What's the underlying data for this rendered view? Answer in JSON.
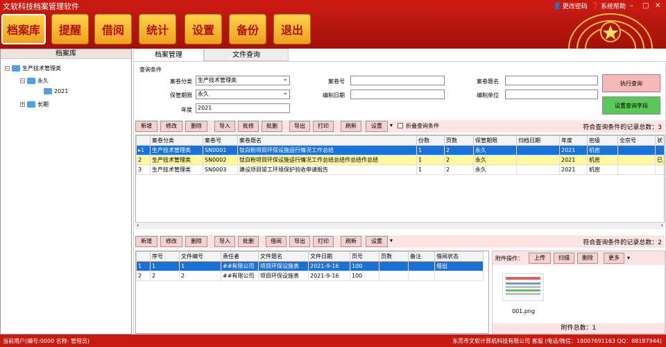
{
  "app": {
    "title": "文软科技档案管理软件",
    "change_password": "更改密码",
    "help": "系统帮助"
  },
  "mainmenu": [
    "档案库",
    "提醒",
    "借阅",
    "统计",
    "设置",
    "备份",
    "退出"
  ],
  "sidebar": {
    "header": "档案库",
    "tree": {
      "root": "生产技术管理类",
      "child1": "永久",
      "child1_1": "2021",
      "child2": "长期"
    }
  },
  "tabs": [
    "档案管理",
    "文件查询"
  ],
  "query": {
    "group_label": "查询条件",
    "category_label": "案卷分类",
    "category_value": "生产技术管理类",
    "period_label": "保管期限",
    "period_value": "永久",
    "year_label": "年度",
    "year_value": "2021",
    "file_no_label": "案卷号",
    "file_no_value": "",
    "date_label": "编制日期",
    "date_value": "",
    "title_label": "案卷题名",
    "title_value": "",
    "unit_label": "编制单位",
    "unit_value": "",
    "run_btn": "执行查询",
    "set_fields_btn": "设置查询字段"
  },
  "toolbar1": {
    "buttons": [
      "新增",
      "修改",
      "删除",
      "导入",
      "批修",
      "批删",
      "导出",
      "打印",
      "刷新",
      "设置"
    ],
    "fold_label": "折叠查询条件",
    "count_text": "符合查询条件的记录总数：3"
  },
  "table1": {
    "headers": [
      "",
      "案卷分类",
      "案卷号",
      "案卷题名",
      "份数",
      "页数",
      "保管期限",
      "归档日期",
      "年度",
      "密级",
      "全宗号",
      "状"
    ],
    "rows": [
      [
        "▸1",
        "生产技术管理类",
        "SN0001",
        "钛白粉项目环保设施运行情况工作总结",
        "1",
        "2",
        "永久",
        "",
        "2021",
        "机密",
        "",
        ""
      ],
      [
        "2",
        "生产技术管理类",
        "SN0002",
        "钛白粉项目环保设施运行情况工作总结总结作总结作总结",
        "1",
        "2",
        "永久",
        "",
        "2021",
        "机密",
        "",
        "已"
      ],
      [
        "3",
        "生产技术管理类",
        "SN0003",
        "建设项目竣工环境保护验收申请报告",
        "1",
        "2",
        "永久",
        "",
        "2021",
        "机密",
        "",
        ""
      ]
    ]
  },
  "toolbar2": {
    "buttons": [
      "新增",
      "修改",
      "删除",
      "导入",
      "批删",
      "借阅",
      "导出",
      "打印",
      "刷新",
      "设置"
    ],
    "count_text": "符合查询条件的记录总数：2"
  },
  "table2": {
    "headers": [
      "",
      "序号",
      "文件编号",
      "责任者",
      "文件题名",
      "文件日期",
      "页号",
      "页数",
      "备注",
      "借阅状态"
    ],
    "rows": [
      [
        "1",
        "1",
        "1",
        "##有限公司",
        "项目环保设施表",
        "2021-9-16",
        "100",
        "",
        "",
        "借出"
      ],
      [
        "2",
        "2",
        "2",
        "##有限公司",
        "项目环保设施表",
        "2021-9-16",
        "100",
        "",
        "",
        ""
      ]
    ]
  },
  "attach": {
    "label": "附件操作：",
    "buttons": [
      "上传",
      "扫描",
      "删除",
      "更多"
    ],
    "file_name": "001.png",
    "total_text": "附件总数：1"
  },
  "status": {
    "left": "当前用户(编号:0000 名称: 管理员)",
    "right": "东莞市文软计算机科技有限公司   客服 (电话/微信：18007691163  QQ：88187944)"
  },
  "colors": {
    "brand_red": "#c81a10",
    "button_gold": "#ffd24a",
    "selected_row": "#1a72d8",
    "highlight_row": "#fff8a0",
    "run_btn": "#f7b8b8",
    "set_btn": "#5cc85c"
  }
}
